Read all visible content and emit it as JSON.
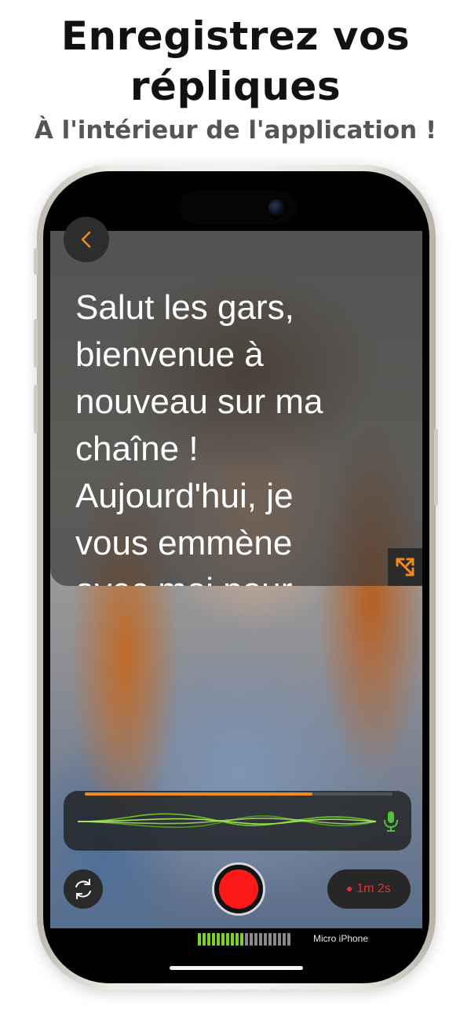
{
  "headline": {
    "line1": "Enregistrez vos",
    "line2": "répliques",
    "subtitle": "À l'intérieur de l'application !"
  },
  "teleprompter": {
    "lines": [
      "Salut les gars,",
      "bienvenue à",
      "nouveau sur ma",
      "chaîne !",
      "Aujourd'hui, je",
      "vous emmène",
      "avec moi pour"
    ]
  },
  "recording": {
    "progress": 0.74,
    "timer": "1m 2s",
    "accent_color": "#f08a1e",
    "record_color": "#ff1a1a",
    "wave_color": "#6ec22b"
  },
  "input_meter": {
    "active_segments": 10,
    "total_segments": 20,
    "label": "Micro iPhone"
  },
  "icons": {
    "back": "chevron-left-icon",
    "expand": "expand-arrows-icon",
    "mic": "microphone-icon",
    "switch_camera": "camera-switch-icon"
  }
}
